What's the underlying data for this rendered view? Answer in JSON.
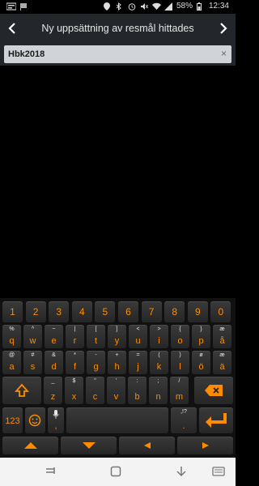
{
  "status": {
    "battery": "58%",
    "time": "12:34"
  },
  "header": {
    "title": "Ny uppsättning av resmål hittades"
  },
  "search": {
    "value": "Hbk2018",
    "clear_glyph": "×"
  },
  "keyboard": {
    "number_row": [
      "1",
      "2",
      "3",
      "4",
      "5",
      "6",
      "7",
      "8",
      "9",
      "0"
    ],
    "row1": [
      {
        "sub": "%",
        "main": "q"
      },
      {
        "sub": "^",
        "main": "w"
      },
      {
        "sub": "~",
        "main": "e"
      },
      {
        "sub": "|",
        "main": "r"
      },
      {
        "sub": "[",
        "main": "t"
      },
      {
        "sub": "]",
        "main": "y"
      },
      {
        "sub": "<",
        "main": "u"
      },
      {
        "sub": ">",
        "main": "i"
      },
      {
        "sub": "{",
        "main": "o"
      },
      {
        "sub": "}",
        "main": "p"
      },
      {
        "sub": "æ",
        "main": "å"
      }
    ],
    "row2": [
      {
        "sub": "@",
        "main": "a"
      },
      {
        "sub": "#",
        "main": "s"
      },
      {
        "sub": "&",
        "main": "d"
      },
      {
        "sub": "*",
        "main": "f"
      },
      {
        "sub": "-",
        "main": "g"
      },
      {
        "sub": "+",
        "main": "h"
      },
      {
        "sub": "=",
        "main": "j"
      },
      {
        "sub": "(",
        "main": "k"
      },
      {
        "sub": ")",
        "main": "l"
      },
      {
        "sub": "ø",
        "main": "ö"
      },
      {
        "sub": "æ",
        "main": "ä"
      }
    ],
    "row3": [
      {
        "sub": "_",
        "main": "z"
      },
      {
        "sub": "$",
        "main": "x"
      },
      {
        "sub": "\"",
        "main": "c"
      },
      {
        "sub": "'",
        "main": "v"
      },
      {
        "sub": ":",
        "main": "b"
      },
      {
        "sub": ";",
        "main": "n"
      },
      {
        "sub": "/",
        "main": "m"
      }
    ],
    "mode_label": "123",
    "comma": ",",
    "period_sub": ",!?",
    "period": "."
  },
  "colors": {
    "accent": "#ff8c00",
    "header_bg": "#23262b",
    "key_bg": "#2c2c2c"
  }
}
